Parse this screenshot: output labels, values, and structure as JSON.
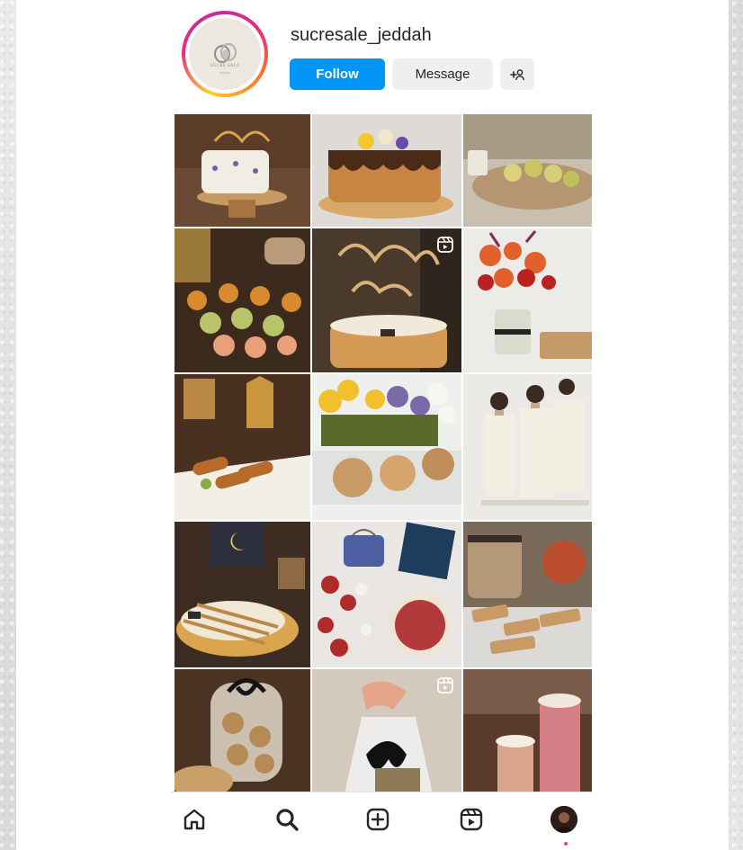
{
  "profile": {
    "username": "sucresale_jeddah",
    "logo_text": "SUCRE SALÉ",
    "logo_subtext": "JEDDAH"
  },
  "actions": {
    "follow_label": "Follow",
    "message_label": "Message",
    "add_user_icon": "add-person-icon"
  },
  "colors": {
    "follow_blue": "#0095f6",
    "story_ring": [
      "#f9ce34",
      "#ee2a7b",
      "#c32aa3"
    ],
    "notification_dot": "#ed4956"
  },
  "grid": {
    "columns": 3,
    "rows": 5,
    "posts": [
      {
        "subject": "cake-with-topper"
      },
      {
        "subject": "chocolate-drip-cake"
      },
      {
        "subject": "pistachio-pastries"
      },
      {
        "subject": "cupcakes-platter"
      },
      {
        "subject": "cake-with-arabic-topper",
        "reel": true
      },
      {
        "subject": "flowers-and-cookies"
      },
      {
        "subject": "lantern-and-rolls"
      },
      {
        "subject": "flower-arrangement-with-cookies"
      },
      {
        "subject": "three-women-in-white"
      },
      {
        "subject": "crescent-tart"
      },
      {
        "subject": "flowers-and-bags"
      },
      {
        "subject": "biscotti-and-tea"
      },
      {
        "subject": "cookie-jar"
      },
      {
        "subject": "gift-wrapping",
        "reel": true
      },
      {
        "subject": "pink-drinks"
      }
    ]
  },
  "bottom_nav": {
    "items": [
      "home-icon",
      "search-icon",
      "create-post-icon",
      "reels-icon",
      "profile-avatar"
    ]
  }
}
